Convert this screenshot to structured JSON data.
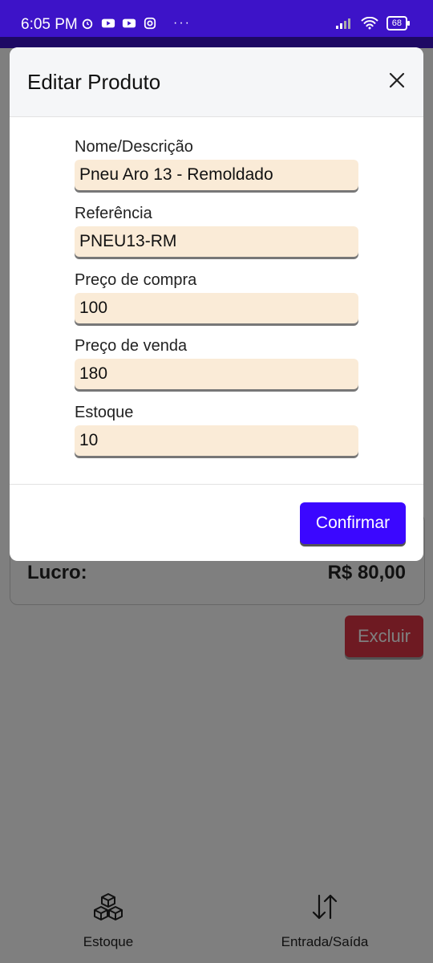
{
  "status_bar": {
    "time": "6:05 PM",
    "battery": "68"
  },
  "background": {
    "lucro_label": "Lucro:",
    "lucro_value": "R$ 80,00",
    "delete_label": "Excluir"
  },
  "bottom_nav": [
    {
      "label": "Estoque",
      "icon": "cubes-icon"
    },
    {
      "label": "Entrada/Saída",
      "icon": "swap-vertical-icon"
    }
  ],
  "modal": {
    "title": "Editar Produto",
    "fields": [
      {
        "label": "Nome/Descrição",
        "value": "Pneu Aro 13 - Remoldado"
      },
      {
        "label": "Referência",
        "value": "PNEU13-RM"
      },
      {
        "label": "Preço de compra",
        "value": "100"
      },
      {
        "label": "Preço de venda",
        "value": "180"
      },
      {
        "label": "Estoque",
        "value": "10"
      }
    ],
    "confirm_label": "Confirmar"
  },
  "colors": {
    "status_bar": "#3d13c8",
    "confirm": "#3b07ff",
    "delete": "#dc3545",
    "input_bg": "#faebd7"
  }
}
